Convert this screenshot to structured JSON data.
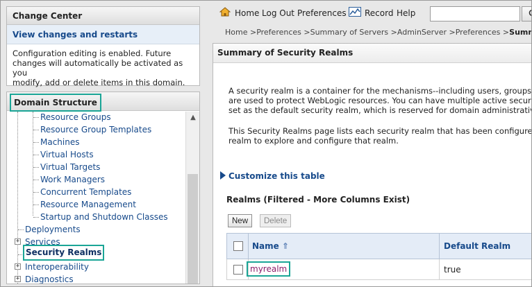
{
  "change_center": {
    "title": "Change Center",
    "link": "View changes and restarts",
    "message_lines": [
      "Configuration editing is enabled. Future",
      "changes will automatically be activated as you",
      "modify, add or delete items in this domain."
    ]
  },
  "domain_structure": {
    "title": "Domain Structure",
    "items": [
      "Resource Groups",
      "Resource Group Templates",
      "Machines",
      "Virtual Hosts",
      "Virtual Targets",
      "Work Managers",
      "Concurrent Templates",
      "Resource Management",
      "Startup and Shutdown Classes",
      "Deployments",
      "Services",
      "Security Realms",
      "Interoperability",
      "Diagnostics"
    ],
    "expander_symbol": "+"
  },
  "toolbar": {
    "home": "Home",
    "logout": "Log Out",
    "preferences": "Preferences",
    "record": "Record",
    "help": "Help",
    "search_placeholder": ""
  },
  "breadcrumb": {
    "trail": "Home >Preferences >Summary of Servers >AdminServer >Preferences >",
    "current": "Summary o"
  },
  "main": {
    "title": "Summary of Security Realms",
    "desc1_lines": [
      "A security realm is a container for the mechanisms--including users, groups, secu",
      "are used to protect WebLogic resources. You can have multiple active security re",
      "set as the default security realm, which is reserved for domain administrative pu"
    ],
    "desc2_lines": [
      "This Security Realms page lists each security realm that has been configured in t",
      "realm to explore and configure that realm."
    ],
    "customize": "Customize this table",
    "table_title": "Realms (Filtered - More Columns Exist)",
    "new_button": "New",
    "delete_button": "Delete",
    "columns": [
      "Name",
      "Default Realm"
    ],
    "sort_indicator": "⇑",
    "rows": [
      {
        "name": "myrealm",
        "default_realm": "true"
      }
    ]
  },
  "colors": {
    "highlight": "#1aa596",
    "link": "#174a8b",
    "visited_link": "#8b1d6b"
  }
}
